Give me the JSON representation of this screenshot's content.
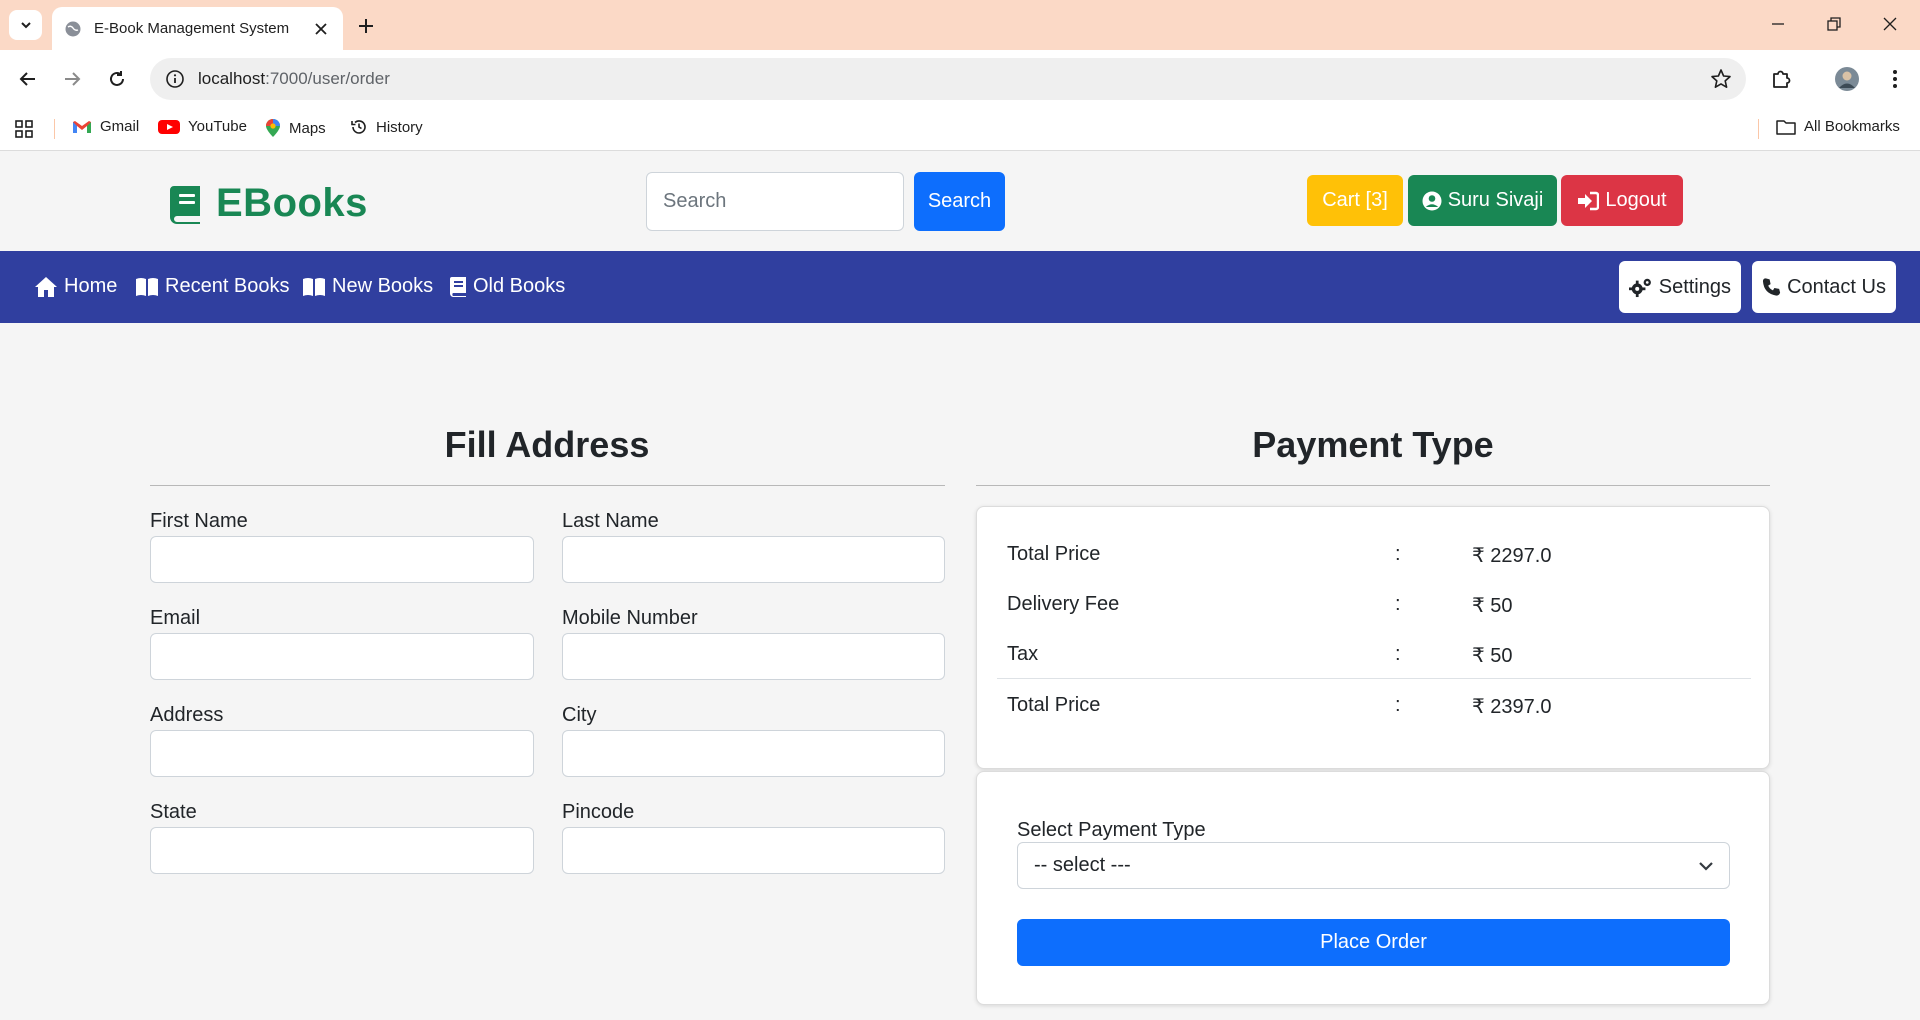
{
  "browser": {
    "tab_title": "E-Book Management System",
    "url_host": "localhost",
    "url_path": ":7000/user/order",
    "bookmarks": [
      "Gmail",
      "YouTube",
      "Maps",
      "History"
    ],
    "all_bookmarks": "All Bookmarks"
  },
  "header": {
    "logo_text": "EBooks",
    "search_placeholder": "Search",
    "search_button": "Search",
    "cart_label": "Cart [3]",
    "user_label": "Suru Sivaji",
    "logout_label": "Logout"
  },
  "nav": {
    "home": "Home",
    "recent_books": "Recent Books",
    "new_books": "New Books",
    "old_books": "Old Books",
    "settings": "Settings",
    "contact_us": "Contact Us"
  },
  "address_form": {
    "title": "Fill Address",
    "fields": {
      "first_name": "First Name",
      "last_name": "Last Name",
      "email": "Email",
      "mobile_number": "Mobile Number",
      "address": "Address",
      "city": "City",
      "state": "State",
      "pincode": "Pincode"
    }
  },
  "payment": {
    "title": "Payment Type",
    "rows": [
      {
        "label": "Total Price",
        "colon": ":",
        "value": "₹ 2297.0"
      },
      {
        "label": "Delivery Fee",
        "colon": ":",
        "value": "₹ 50"
      },
      {
        "label": "Tax",
        "colon": ":",
        "value": "₹ 50"
      },
      {
        "label": "Total Price",
        "colon": ":",
        "value": "₹ 2397.0"
      }
    ],
    "select_label": "Select Payment Type",
    "select_value": "-- select ---",
    "place_order": "Place Order"
  },
  "colors": {
    "nav_bg": "#303f9f",
    "brand_green": "#198754",
    "primary_blue": "#0d6efd",
    "cart_yellow": "#ffc107",
    "logout_red": "#dc3545"
  }
}
